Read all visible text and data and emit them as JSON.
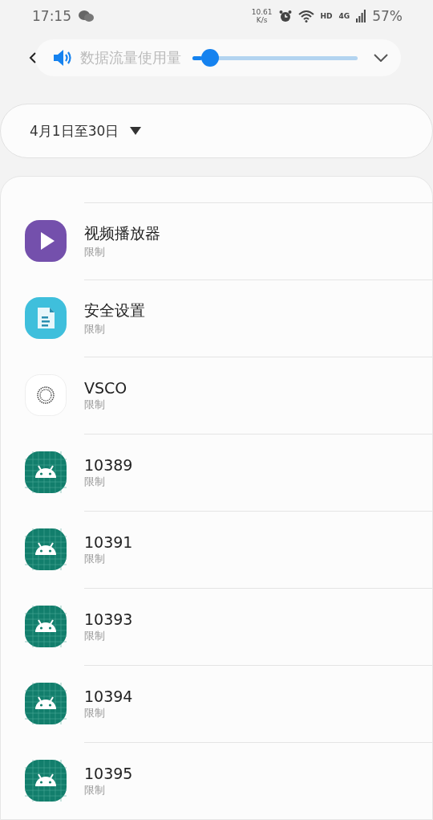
{
  "status_bar": {
    "time": "17:15",
    "speed_value": "10.61",
    "speed_unit": "K/s",
    "hd": "HD",
    "network": "4G",
    "battery": "57%"
  },
  "volume_panel": {
    "title": "数据流量使用量",
    "level": 0.06
  },
  "period": {
    "label": "4月1日至30日"
  },
  "apps": [
    {
      "name": "视频播放器",
      "status": "限制",
      "kind": "video"
    },
    {
      "name": "安全设置",
      "status": "限制",
      "kind": "document"
    },
    {
      "name": "VSCO",
      "status": "限制",
      "kind": "vsco"
    },
    {
      "name": "10389",
      "status": "限制",
      "kind": "android"
    },
    {
      "name": "10391",
      "status": "限制",
      "kind": "android"
    },
    {
      "name": "10393",
      "status": "限制",
      "kind": "android"
    },
    {
      "name": "10394",
      "status": "限制",
      "kind": "android"
    },
    {
      "name": "10395",
      "status": "限制",
      "kind": "android"
    }
  ]
}
